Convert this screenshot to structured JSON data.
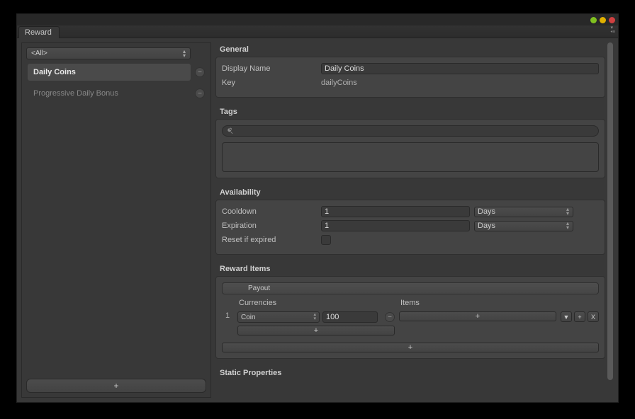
{
  "tab": {
    "label": "Reward"
  },
  "sidebar": {
    "filter": "<All>",
    "items": [
      {
        "label": "Daily Coins",
        "selected": true
      },
      {
        "label": "Progressive Daily Bonus",
        "selected": false
      }
    ],
    "add": "+"
  },
  "sections": {
    "general": {
      "title": "General",
      "display_name_label": "Display Name",
      "display_name_value": "Daily Coins",
      "key_label": "Key",
      "key_value": "dailyCoins"
    },
    "tags": {
      "title": "Tags",
      "search_placeholder": ""
    },
    "availability": {
      "title": "Availability",
      "cooldown_label": "Cooldown",
      "cooldown_value": "1",
      "cooldown_unit": "Days",
      "expiration_label": "Expiration",
      "expiration_value": "1",
      "expiration_unit": "Days",
      "reset_label": "Reset if expired"
    },
    "reward_items": {
      "title": "Reward Items",
      "payout_label": "Payout",
      "currencies_label": "Currencies",
      "items_label": "Items",
      "row_number": "1",
      "currency_name": "Coin",
      "currency_amount": "100",
      "add_currency": "+",
      "add_item": "+",
      "add_payout": "+",
      "ctrl_down": "▼",
      "ctrl_plus": "+",
      "ctrl_x": "X"
    },
    "static_properties": {
      "title": "Static Properties"
    }
  }
}
